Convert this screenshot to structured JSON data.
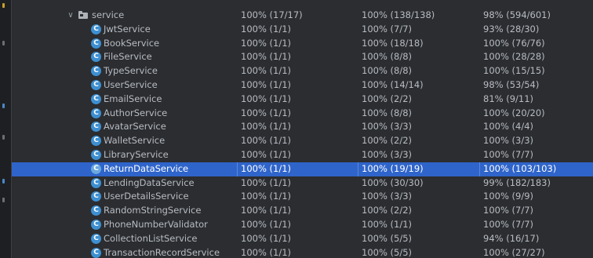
{
  "package": {
    "name": "service",
    "class_pct": "100% (17/17)",
    "method_pct": "100% (138/138)",
    "line_pct": "98% (594/601)"
  },
  "class_icon_letter": "C",
  "selected_index": 10,
  "classes": [
    {
      "name": "JwtService",
      "class_pct": "100% (1/1)",
      "method_pct": "100% (7/7)",
      "line_pct": "93% (28/30)"
    },
    {
      "name": "BookService",
      "class_pct": "100% (1/1)",
      "method_pct": "100% (18/18)",
      "line_pct": "100% (76/76)"
    },
    {
      "name": "FileService",
      "class_pct": "100% (1/1)",
      "method_pct": "100% (8/8)",
      "line_pct": "100% (28/28)"
    },
    {
      "name": "TypeService",
      "class_pct": "100% (1/1)",
      "method_pct": "100% (8/8)",
      "line_pct": "100% (15/15)"
    },
    {
      "name": "UserService",
      "class_pct": "100% (1/1)",
      "method_pct": "100% (14/14)",
      "line_pct": "98% (53/54)"
    },
    {
      "name": "EmailService",
      "class_pct": "100% (1/1)",
      "method_pct": "100% (2/2)",
      "line_pct": "81% (9/11)"
    },
    {
      "name": "AuthorService",
      "class_pct": "100% (1/1)",
      "method_pct": "100% (8/8)",
      "line_pct": "100% (20/20)"
    },
    {
      "name": "AvatarService",
      "class_pct": "100% (1/1)",
      "method_pct": "100% (3/3)",
      "line_pct": "100% (4/4)"
    },
    {
      "name": "WalletService",
      "class_pct": "100% (1/1)",
      "method_pct": "100% (2/2)",
      "line_pct": "100% (3/3)"
    },
    {
      "name": "LibraryService",
      "class_pct": "100% (1/1)",
      "method_pct": "100% (3/3)",
      "line_pct": "100% (7/7)"
    },
    {
      "name": "ReturnDataService",
      "class_pct": "100% (1/1)",
      "method_pct": "100% (19/19)",
      "line_pct": "100% (103/103)"
    },
    {
      "name": "LendingDataService",
      "class_pct": "100% (1/1)",
      "method_pct": "100% (30/30)",
      "line_pct": "99% (182/183)"
    },
    {
      "name": "UserDetailsService",
      "class_pct": "100% (1/1)",
      "method_pct": "100% (3/3)",
      "line_pct": "100% (9/9)"
    },
    {
      "name": "RandomStringService",
      "class_pct": "100% (1/1)",
      "method_pct": "100% (2/2)",
      "line_pct": "100% (7/7)"
    },
    {
      "name": "PhoneNumberValidator",
      "class_pct": "100% (1/1)",
      "method_pct": "100% (1/1)",
      "line_pct": "100% (7/7)"
    },
    {
      "name": "CollectionListService",
      "class_pct": "100% (1/1)",
      "method_pct": "100% (5/5)",
      "line_pct": "94% (16/17)"
    },
    {
      "name": "TransactionRecordService",
      "class_pct": "100% (1/1)",
      "method_pct": "100% (5/5)",
      "line_pct": "100% (27/27)"
    }
  ],
  "colors": {
    "background": "#2b2d30",
    "selection": "#2f65ca",
    "class_icon": "#3d8fd1",
    "text": "#b8bcc3"
  }
}
